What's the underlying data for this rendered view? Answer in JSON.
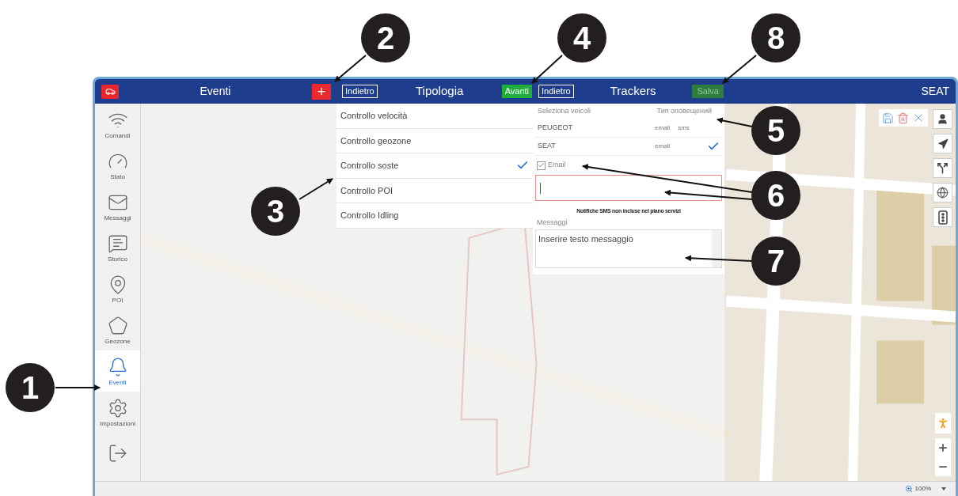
{
  "header": {
    "title": "Eventi",
    "add_button": "+",
    "steps": [
      {
        "back": "Indietro",
        "title": "Tipologia",
        "next": "Avanti",
        "next_enabled": true
      },
      {
        "back": "Indietro",
        "title": "Trackers",
        "next": "Salva",
        "next_enabled": false
      }
    ],
    "vehicle": "SEAT"
  },
  "sidebar": {
    "items": [
      {
        "kind": "wifi",
        "label": "Comandi",
        "selected": false
      },
      {
        "kind": "gauge",
        "label": "Stato",
        "selected": false
      },
      {
        "kind": "mail",
        "label": "Messaggi",
        "selected": false
      },
      {
        "kind": "chat",
        "label": "Storico",
        "selected": false
      },
      {
        "kind": "pin",
        "label": "POI",
        "selected": false
      },
      {
        "kind": "polygon",
        "label": "Geozone",
        "selected": false
      },
      {
        "kind": "bell",
        "label": "Eventi",
        "selected": true
      },
      {
        "kind": "gears",
        "label": "Impostazioni",
        "selected": false
      },
      {
        "kind": "exit",
        "selected": false
      }
    ]
  },
  "event_types": [
    {
      "label": "Controllo velocità",
      "selected": false
    },
    {
      "label": "Controllo geozone",
      "selected": false
    },
    {
      "label": "Controllo soste",
      "selected": true
    },
    {
      "label": "Controllo POI",
      "selected": false
    },
    {
      "label": "Controllo Idling",
      "selected": false
    }
  ],
  "trackers": {
    "columns": [
      "Seleziona veicoli",
      "Тип оповещений"
    ],
    "rows": [
      {
        "name": "PEUGEOT",
        "types": [
          "email",
          "sms"
        ],
        "selected": false
      },
      {
        "name": "SEAT",
        "types": [
          "email"
        ],
        "selected": true
      }
    ],
    "email_checkbox": {
      "label": "Email",
      "checked": true
    },
    "email_field": {
      "invalid": true,
      "focused": true
    },
    "notice": "Notifiche SMS non incluse nel piano servizi",
    "message_label": "Messaggi",
    "message_placeholder": "Inserire testo messaggio"
  },
  "status_bar": {
    "zoom": "100%"
  },
  "callouts": [
    {
      "label": "2"
    },
    {
      "label": "4"
    },
    {
      "label": "8"
    },
    {
      "label": "5"
    },
    {
      "label": "6"
    },
    {
      "label": "3"
    },
    {
      "label": "7"
    },
    {
      "label": "1"
    }
  ]
}
